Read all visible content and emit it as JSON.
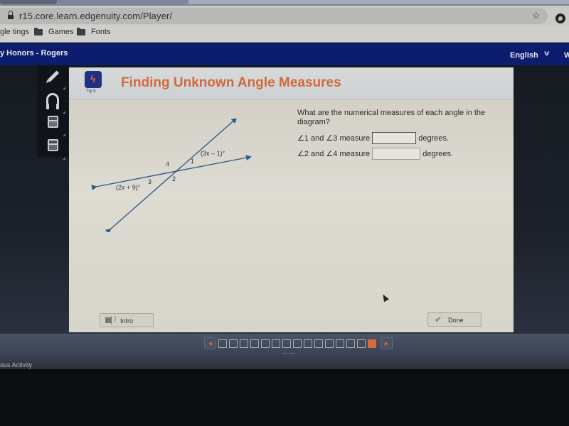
{
  "browser": {
    "url": "r15.core.learn.edgenuity.com/Player/",
    "bookmarks": [
      {
        "label": "gle tings",
        "icon": "none"
      },
      {
        "label": "Games",
        "icon": "folder-icon"
      },
      {
        "label": "Fonts",
        "icon": "folder-icon"
      }
    ],
    "icons": {
      "lock": "lock-icon",
      "bookmark_star": "star-icon",
      "extension": "extension-icon"
    }
  },
  "app_header": {
    "course_title": "y Honors - Rogers",
    "language": "English",
    "language_chevron": "⌄",
    "overflow_text": "W"
  },
  "tools": [
    {
      "name": "pencil",
      "icon": "pencil-icon"
    },
    {
      "name": "audio",
      "icon": "headphones-icon"
    },
    {
      "name": "calculator",
      "icon": "calculator-icon"
    },
    {
      "name": "scientific-calculator",
      "icon": "calculator-icon"
    }
  ],
  "lesson": {
    "badge_icon": "lightning-icon",
    "badge_label": "Try It",
    "title": "Finding Unknown Angle Measures",
    "accent_color": "#d06a3e"
  },
  "diagram": {
    "angle_labels": [
      "1",
      "2",
      "3",
      "4"
    ],
    "expr_angle1": "(3x – 1)°",
    "expr_angle3": "(2x + 9)°",
    "line_color": "#2f5d86"
  },
  "question": {
    "prompt": "What are the numerical measures of each angle in the diagram?",
    "rows": [
      {
        "label": "∠1 and ∠3 measure",
        "value": "",
        "suffix": "degrees."
      },
      {
        "label": "∠2 and ∠4 measure",
        "value": "",
        "suffix": "degrees."
      }
    ]
  },
  "footer": {
    "intro_label": "Intro",
    "done_label": "Done"
  },
  "pager": {
    "total_pages": 15,
    "current_page": 15,
    "prev_symbol": "◀",
    "next_symbol": "▶",
    "dots": "•• •••"
  },
  "bottom": {
    "previous_activity": "ous Activity"
  }
}
